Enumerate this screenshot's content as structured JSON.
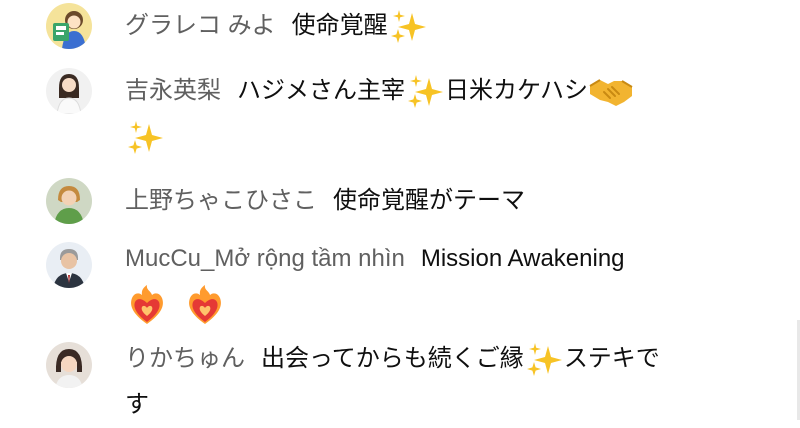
{
  "messages": [
    {
      "author": "グラレコ みよ",
      "text": "使命覚醒",
      "emojis": [
        "sparkles"
      ]
    },
    {
      "author": "吉永英梨",
      "text_parts": [
        "ハジメさん主宰",
        "日米カケハシ"
      ],
      "emojis": [
        "sparkles",
        "handshake",
        "sparkles"
      ]
    },
    {
      "author": "上野ちゃこひさこ",
      "text": "使命覚醒がテーマ"
    },
    {
      "author": "MucCu_Mở rộng tầm nhìn",
      "text": "Mission Awakening",
      "emojis": [
        "heart-on-fire",
        "heart-on-fire"
      ]
    },
    {
      "author": "りかちゅん",
      "text_parts": [
        "出会ってからも続くご縁",
        "ステキで",
        "す"
      ],
      "emojis": [
        "sparkles"
      ]
    }
  ],
  "colors": {
    "author_text": "#606060",
    "message_text": "#0f0f0f",
    "sparkle": "#f7c325",
    "handshake": "#f2b430",
    "heart_fire": "#e53935"
  }
}
